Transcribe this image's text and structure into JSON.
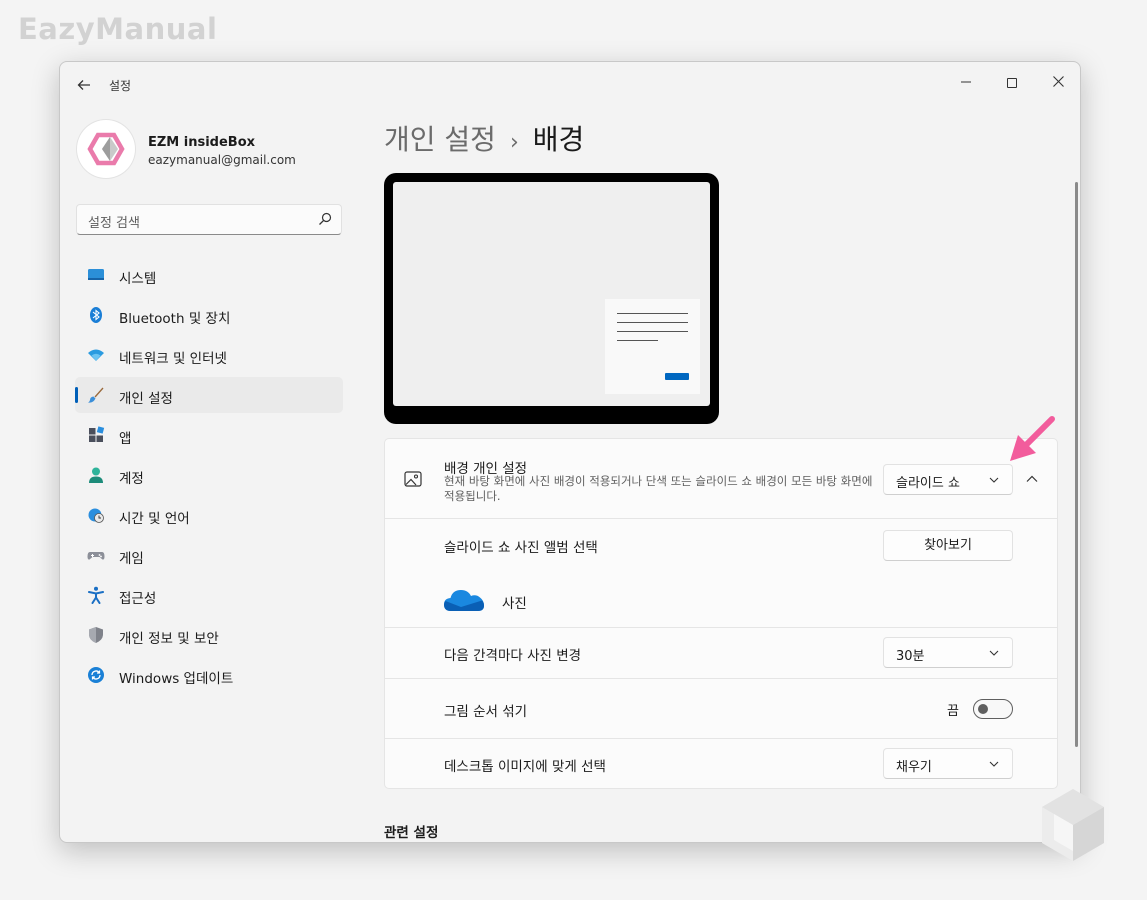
{
  "watermark": "EazyManual",
  "window": {
    "title": "설정"
  },
  "profile": {
    "name": "EZM insideBox",
    "email": "eazymanual@gmail.com"
  },
  "search": {
    "placeholder": "설정 검색"
  },
  "nav": {
    "items": [
      {
        "label": "시스템",
        "icon": "monitor-icon"
      },
      {
        "label": "Bluetooth 및 장치",
        "icon": "bluetooth-icon"
      },
      {
        "label": "네트워크 및 인터넷",
        "icon": "wifi-icon"
      },
      {
        "label": "개인 설정",
        "icon": "brush-icon",
        "selected": true
      },
      {
        "label": "앱",
        "icon": "apps-icon"
      },
      {
        "label": "계정",
        "icon": "person-icon"
      },
      {
        "label": "시간 및 언어",
        "icon": "clock-globe-icon"
      },
      {
        "label": "게임",
        "icon": "gamepad-icon"
      },
      {
        "label": "접근성",
        "icon": "accessibility-icon"
      },
      {
        "label": "개인 정보 및 보안",
        "icon": "shield-icon"
      },
      {
        "label": "Windows 업데이트",
        "icon": "update-icon"
      }
    ]
  },
  "breadcrumb": {
    "parent": "개인 설정",
    "separator": "›",
    "current": "배경"
  },
  "background": {
    "title": "배경 개인 설정",
    "description": "현재 바탕 화면에 사진 배경이 적용되거나 단색 또는 슬라이드 쇼 배경이 모든 바탕 화면에 적용됩니다.",
    "value": "슬라이드 쇼"
  },
  "album": {
    "label": "슬라이드 쇼 사진 앨범 선택",
    "browse": "찾아보기",
    "folder": "사진"
  },
  "interval": {
    "label": "다음 간격마다 사진 변경",
    "value": "30분"
  },
  "shuffle": {
    "label": "그림 순서 섞기",
    "state": "끔",
    "on": false
  },
  "fit": {
    "label": "데스크톱 이미지에 맞게 선택",
    "value": "채우기"
  },
  "related": {
    "title": "관련 설정"
  },
  "colors": {
    "accent": "#005fb8",
    "annotation": "#f25c9c"
  }
}
